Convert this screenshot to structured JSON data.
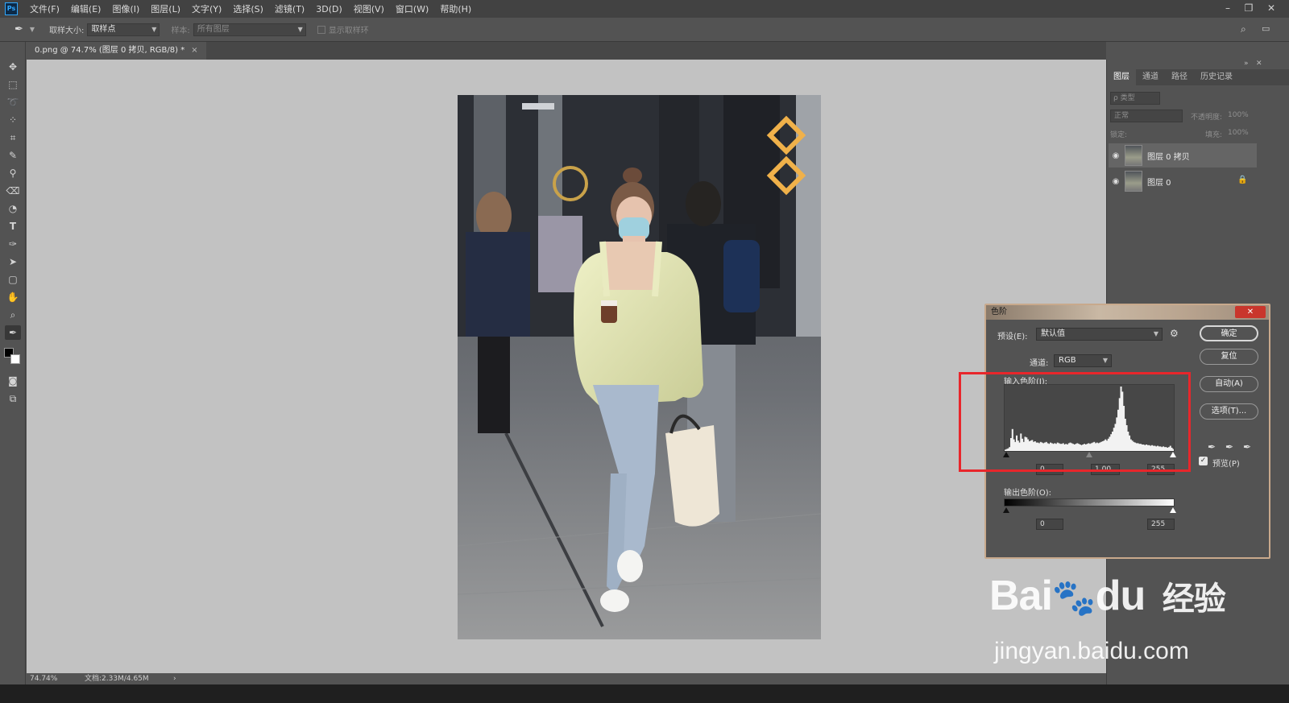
{
  "menubar": {
    "logo": "Ps",
    "items": [
      "文件(F)",
      "编辑(E)",
      "图像(I)",
      "图层(L)",
      "文字(Y)",
      "选择(S)",
      "滤镜(T)",
      "3D(D)",
      "视图(V)",
      "窗口(W)",
      "帮助(H)"
    ],
    "window_controls": [
      "–",
      "❐",
      "✕"
    ]
  },
  "options": {
    "sample_size_label": "取样大小:",
    "sample_size_value": "取样点",
    "sample_label": "样本:",
    "sample_value": "所有图层",
    "show_ring_label": "显示取样环"
  },
  "document": {
    "tab_title": "0.png @ 74.7% (图层 0 拷贝, RGB/8) *",
    "tab_close": "×"
  },
  "status": {
    "zoom": "74.74%",
    "doc_size": "文档:2.33M/4.65M",
    "arrow": "›"
  },
  "layers_panel": {
    "tabs": [
      "图层",
      "通道",
      "路径",
      "历史记录"
    ],
    "filter_placeholder": "ρ 类型",
    "blend_mode": "正常",
    "opacity_label": "不透明度:",
    "opacity_value": "100%",
    "lock_label": "锁定:",
    "fill_label": "填充:",
    "fill_value": "100%",
    "layers": [
      {
        "name": "图层 0 拷贝",
        "visible": true,
        "selected": true,
        "locked": false
      },
      {
        "name": "图层 0",
        "visible": true,
        "selected": false,
        "locked": true
      }
    ]
  },
  "levels_dialog": {
    "title": "色阶",
    "close": "✕",
    "preset_label": "预设(E):",
    "preset_value": "默认值",
    "channel_label": "通道:",
    "channel_value": "RGB",
    "input_levels_label": "输入色阶(I):",
    "input_black": "0",
    "input_gamma": "1.00",
    "input_white": "255",
    "output_levels_label": "输出色阶(O):",
    "output_black": "0",
    "output_white": "255",
    "buttons": {
      "ok": "确定",
      "reset": "复位",
      "auto": "自动(A)",
      "options": "选项(T)..."
    },
    "preview_label": "预览(P)",
    "preview_checked": true,
    "histogram": [
      2,
      3,
      4,
      6,
      20,
      34,
      18,
      14,
      24,
      16,
      13,
      27,
      19,
      14,
      22,
      21,
      18,
      15,
      16,
      17,
      14,
      15,
      13,
      13,
      12,
      14,
      13,
      12,
      13,
      14,
      12,
      11,
      13,
      12,
      11,
      12,
      11,
      13,
      12,
      11,
      11,
      12,
      10,
      11,
      10,
      12,
      13,
      12,
      11,
      10,
      11,
      12,
      11,
      10,
      9,
      10,
      11,
      10,
      11,
      12,
      11,
      12,
      13,
      14,
      12,
      13,
      12,
      13,
      14,
      15,
      16,
      18,
      16,
      19,
      22,
      26,
      30,
      36,
      42,
      52,
      64,
      82,
      100,
      92,
      70,
      50,
      40,
      30,
      24,
      18,
      16,
      14,
      13,
      12,
      12,
      11,
      11,
      10,
      10,
      9,
      10,
      9,
      9,
      8,
      9,
      8,
      8,
      7,
      8,
      7,
      7,
      6,
      7,
      6,
      6,
      5,
      6,
      8,
      5,
      3
    ]
  },
  "watermark": {
    "brand_part1": "Bai",
    "brand_part2": "du",
    "brand_cn": "经验",
    "url": "jingyan.baidu.com"
  },
  "colors": {
    "highlight": "#e8262b",
    "ps_blue": "#31a8ff"
  }
}
